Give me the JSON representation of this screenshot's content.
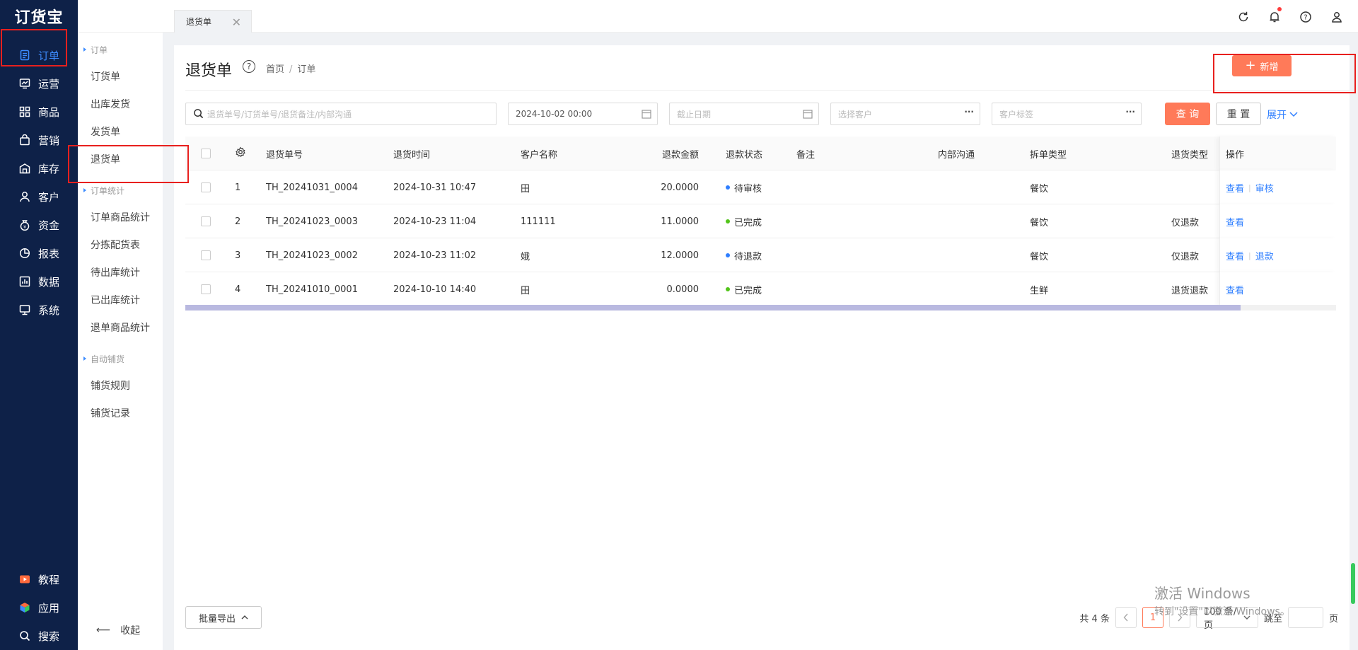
{
  "app": {
    "logo": "订货宝"
  },
  "nav": {
    "items": [
      {
        "label": "订单",
        "icon": "order-icon",
        "active": true
      },
      {
        "label": "运营",
        "icon": "operations-icon"
      },
      {
        "label": "商品",
        "icon": "products-icon"
      },
      {
        "label": "营销",
        "icon": "marketing-icon"
      },
      {
        "label": "库存",
        "icon": "warehouse-icon"
      },
      {
        "label": "客户",
        "icon": "user-icon"
      },
      {
        "label": "资金",
        "icon": "money-bag-icon"
      },
      {
        "label": "报表",
        "icon": "pie-chart-icon"
      },
      {
        "label": "数据",
        "icon": "data-icon"
      },
      {
        "label": "系统",
        "icon": "monitor-icon"
      }
    ],
    "bottom": [
      {
        "label": "教程",
        "icon": "play-icon"
      },
      {
        "label": "应用",
        "icon": "cube-icon"
      },
      {
        "label": "搜索",
        "icon": "search-icon"
      }
    ]
  },
  "submenu": {
    "group1": "订单",
    "items1": [
      "订货单",
      "出库发货",
      "发货单",
      "退货单"
    ],
    "group2": "订单统计",
    "items2": [
      "订单商品统计",
      "分拣配货表",
      "待出库统计",
      "已出库统计",
      "退单商品统计"
    ],
    "group3": "自动铺货",
    "items3": [
      "铺货规则",
      "铺货记录"
    ],
    "collapse": "收起"
  },
  "tabs": [
    {
      "label": "退货单"
    }
  ],
  "page": {
    "title": "退货单",
    "breadcrumb": [
      "首页",
      "订单"
    ],
    "add_label": "新增"
  },
  "filters": {
    "search_placeholder": "退货单号/订货单号/退货备注/内部沟通",
    "start_date": "2024-10-02 00:00",
    "end_date_placeholder": "截止日期",
    "customer_placeholder": "选择客户",
    "tag_placeholder": "客户标签",
    "query_label": "查 询",
    "reset_label": "重 置",
    "expand_label": "展开"
  },
  "table": {
    "columns": [
      "退货单号",
      "退货时间",
      "客户名称",
      "退款金额",
      "退款状态",
      "备注",
      "内部沟通",
      "拆单类型",
      "退货类型",
      "操作"
    ],
    "rows": [
      {
        "idx": "1",
        "no": "TH_20241031_0004",
        "time": "2024-10-31 10:47",
        "customer": "田",
        "amount": "20.0000",
        "status": "待审核",
        "status_color": "#2f7fff",
        "note": "",
        "comm": "",
        "split": "餐饮",
        "rtype": "",
        "actions": [
          "查看",
          "审核"
        ]
      },
      {
        "idx": "2",
        "no": "TH_20241023_0003",
        "time": "2024-10-23 11:04",
        "customer": "111111",
        "amount": "11.0000",
        "status": "已完成",
        "status_color": "#52c41a",
        "note": "",
        "comm": "",
        "split": "餐饮",
        "rtype": "仅退款",
        "actions": [
          "查看"
        ]
      },
      {
        "idx": "3",
        "no": "TH_20241023_0002",
        "time": "2024-10-23 11:02",
        "customer": "娥",
        "amount": "12.0000",
        "status": "待退款",
        "status_color": "#2f7fff",
        "note": "",
        "comm": "",
        "split": "餐饮",
        "rtype": "仅退款",
        "actions": [
          "查看",
          "退款"
        ]
      },
      {
        "idx": "4",
        "no": "TH_20241010_0001",
        "time": "2024-10-10 14:40",
        "customer": "田",
        "amount": "0.0000",
        "status": "已完成",
        "status_color": "#52c41a",
        "note": "",
        "comm": "",
        "split": "生鲜",
        "rtype": "退货退款",
        "actions": [
          "查看"
        ]
      }
    ]
  },
  "footer": {
    "batch_export": "批量导出",
    "total": "共 4 条",
    "current_page": "1",
    "page_size": "100 条/页",
    "jump_label": "跳至",
    "page_unit": "页"
  },
  "watermark": {
    "line1": "激活 Windows",
    "line2": "转到\"设置\"以激活 Windows。"
  },
  "colors": {
    "sidebar": "#0e2148",
    "accent": "#ff7a59",
    "link": "#2f7fff",
    "annotation": "#e8201e"
  }
}
